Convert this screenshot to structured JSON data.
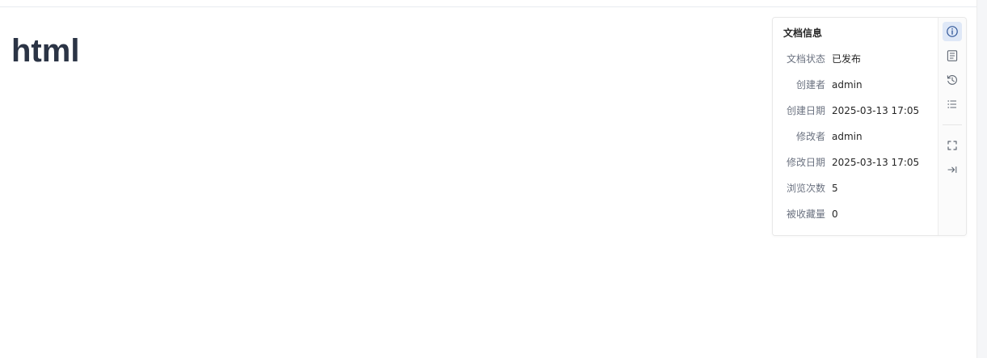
{
  "document": {
    "title": "html"
  },
  "info_panel": {
    "heading": "文档信息",
    "rows": [
      {
        "label": "文档状态",
        "value": "已发布"
      },
      {
        "label": "创建者",
        "value": "admin"
      },
      {
        "label": "创建日期",
        "value": "2025-03-13 17:05"
      },
      {
        "label": "修改者",
        "value": "admin"
      },
      {
        "label": "修改日期",
        "value": "2025-03-13 17:05"
      },
      {
        "label": "浏览次数",
        "value": "5"
      },
      {
        "label": "被收藏量",
        "value": "0"
      }
    ]
  },
  "toolbar": {
    "buttons": [
      {
        "icon": "info-icon",
        "active": true
      },
      {
        "icon": "document-outline-icon",
        "active": false
      },
      {
        "icon": "history-icon",
        "active": false
      },
      {
        "icon": "list-icon",
        "active": false
      },
      {
        "icon": "fullscreen-icon",
        "active": false
      },
      {
        "icon": "collapse-panel-icon",
        "active": false
      }
    ]
  },
  "colors": {
    "title": "#2b3445",
    "label": "#6b7280",
    "value": "#262626",
    "active_tool_bg": "#dfe8f7",
    "icon": "#5f6773",
    "active_icon": "#2f5597"
  }
}
